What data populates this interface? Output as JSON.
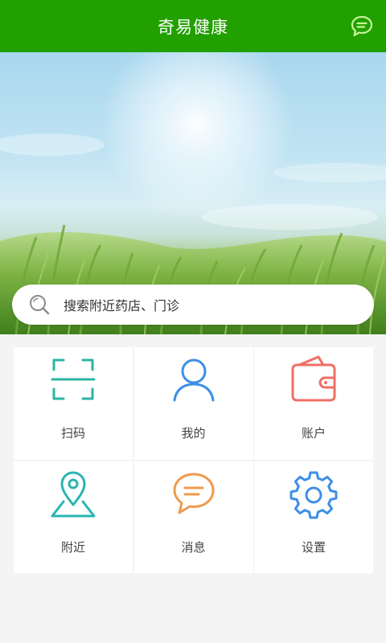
{
  "header": {
    "title": "奇易健康",
    "chat_icon": "chat-bubble-icon"
  },
  "colors": {
    "brand_green": "#21a000",
    "scan_teal": "#2bb5a3",
    "user_blue": "#3d8fe6",
    "wallet_red": "#ef6f64",
    "location_teal": "#2bb5b0",
    "message_orange": "#ef9a4e",
    "settings_blue": "#3d8fe6"
  },
  "search": {
    "placeholder": "搜索附近药店、门诊",
    "icon": "search-icon"
  },
  "menu": [
    {
      "label": "扫码",
      "icon": "scan-icon"
    },
    {
      "label": "我的",
      "icon": "user-icon"
    },
    {
      "label": "账户",
      "icon": "wallet-icon"
    },
    {
      "label": "附近",
      "icon": "location-icon"
    },
    {
      "label": "消息",
      "icon": "message-icon"
    },
    {
      "label": "设置",
      "icon": "settings-icon"
    }
  ]
}
